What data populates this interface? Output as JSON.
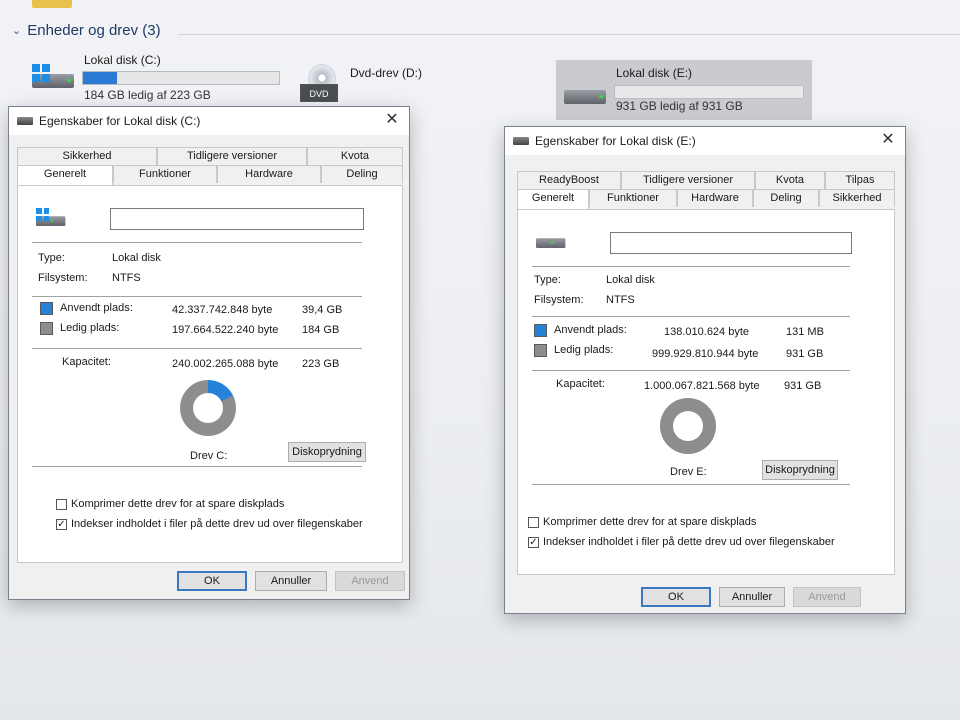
{
  "explorer": {
    "section_header": "Enheder og drev (3)",
    "drives": [
      {
        "name": "Lokal disk (C:)",
        "space": "184 GB ledig af 223 GB",
        "used_fraction": 0.175
      },
      {
        "name": "Dvd-drev (D:)",
        "badge": "DVD"
      },
      {
        "name": "Lokal disk (E:)",
        "space": "931 GB ledig af 931 GB",
        "used_fraction": 0.0
      }
    ]
  },
  "dialog_c": {
    "title": "Egenskaber for Lokal disk (C:)",
    "tabs_back": [
      "Sikkerhed",
      "Tidligere versioner",
      "Kvota"
    ],
    "tabs_front": [
      "Generelt",
      "Funktioner",
      "Hardware",
      "Deling"
    ],
    "name_value": "",
    "type_label": "Type:",
    "type_value": "Lokal disk",
    "fs_label": "Filsystem:",
    "fs_value": "NTFS",
    "used_label": "Anvendt plads:",
    "used_bytes": "42.337.742.848 byte",
    "used_size": "39,4 GB",
    "free_label": "Ledig plads:",
    "free_bytes": "197.664.522.240 byte",
    "free_size": "184 GB",
    "cap_label": "Kapacitet:",
    "cap_bytes": "240.002.265.088 byte",
    "cap_size": "223 GB",
    "used_fraction": 0.176,
    "drive_label": "Drev C:",
    "cleanup_button": "Diskoprydning",
    "compress_label": "Komprimer dette drev for at spare diskplads",
    "compress_checked": false,
    "index_label": "Indekser indholdet i filer på dette drev ud over filegenskaber",
    "index_checked": true,
    "ok": "OK",
    "cancel": "Annuller",
    "apply": "Anvend"
  },
  "dialog_e": {
    "title": "Egenskaber for Lokal disk (E:)",
    "tabs_back": [
      "ReadyBoost",
      "Tidligere versioner",
      "Kvota",
      "Tilpas"
    ],
    "tabs_front": [
      "Generelt",
      "Funktioner",
      "Hardware",
      "Deling",
      "Sikkerhed"
    ],
    "name_value": "",
    "type_label": "Type:",
    "type_value": "Lokal disk",
    "fs_label": "Filsystem:",
    "fs_value": "NTFS",
    "used_label": "Anvendt plads:",
    "used_bytes": "138.010.624 byte",
    "used_size": "131 MB",
    "free_label": "Ledig plads:",
    "free_bytes": "999.929.810.944 byte",
    "free_size": "931 GB",
    "cap_label": "Kapacitet:",
    "cap_bytes": "1.000.067.821.568 byte",
    "cap_size": "931 GB",
    "used_fraction": 0.0001,
    "drive_label": "Drev E:",
    "cleanup_button": "Diskoprydning",
    "compress_label": "Komprimer dette drev for at spare diskplads",
    "compress_checked": false,
    "index_label": "Indekser indholdet i filer på dette drev ud over filegenskaber",
    "index_checked": true,
    "ok": "OK",
    "cancel": "Annuller",
    "apply": "Anvend"
  },
  "colors": {
    "used": "#2682d6",
    "free": "#8d8d8d",
    "accent": "#2a7bd3"
  }
}
